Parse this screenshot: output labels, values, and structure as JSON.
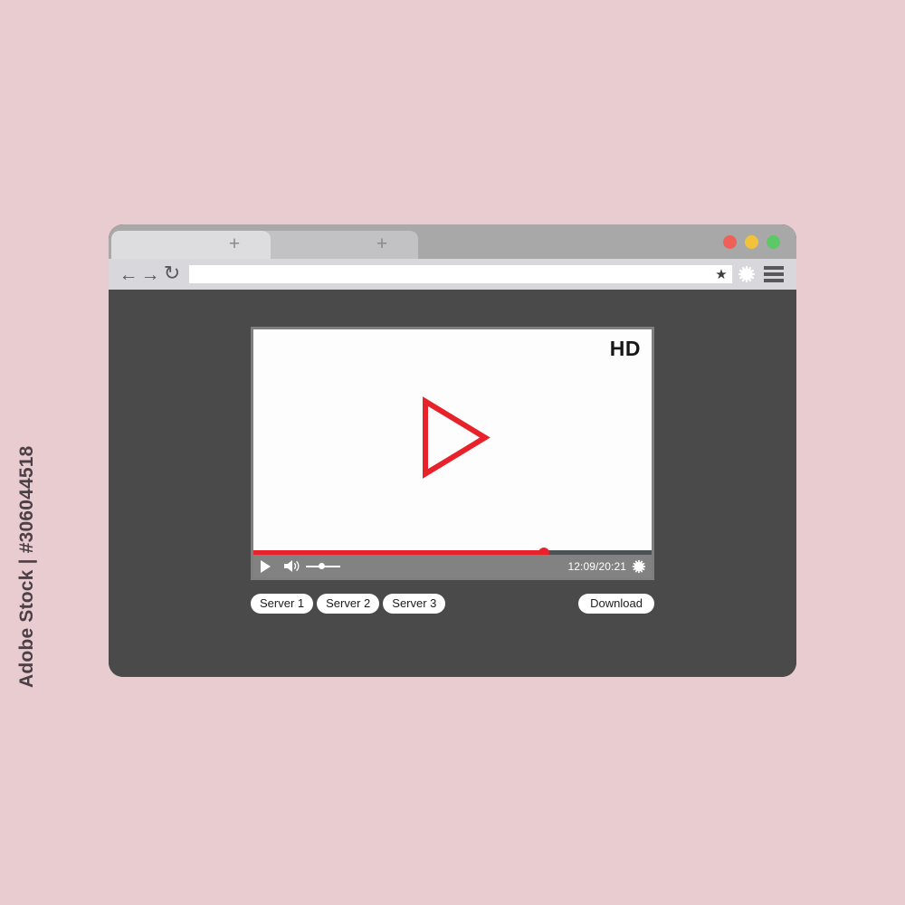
{
  "watermark": {
    "text": "Adobe Stock | #306044518"
  },
  "background_color": "#e9ccd0",
  "browser": {
    "window_color": "#4a4a4a",
    "tabs": [
      {
        "name": "tab-1",
        "label": "",
        "plus_label": "+",
        "active": true
      },
      {
        "name": "tab-2",
        "label": "",
        "plus_label": "+",
        "active": false
      }
    ],
    "window_controls": [
      {
        "name": "close",
        "color": "#ef6158"
      },
      {
        "name": "minimize",
        "color": "#f2c23b"
      },
      {
        "name": "maximize",
        "color": "#5cc866"
      }
    ],
    "toolbar": {
      "back_icon": "←",
      "forward_icon": "→",
      "reload_icon": "↻",
      "bookmark_icon": "★",
      "url_value": "",
      "url_placeholder": ""
    }
  },
  "player": {
    "hd_badge": "HD",
    "play_icon": "play-triangle",
    "time_display": "12:09/20:21",
    "progress_percent": 73,
    "volume_percent": 45,
    "accent_color": "#e8222a",
    "screen_color": "#fdfdfd",
    "control_bar_color": "#828282"
  },
  "actions": {
    "servers": [
      {
        "label": "Server 1"
      },
      {
        "label": "Server 2"
      },
      {
        "label": "Server 3"
      }
    ],
    "download_label": "Download"
  }
}
